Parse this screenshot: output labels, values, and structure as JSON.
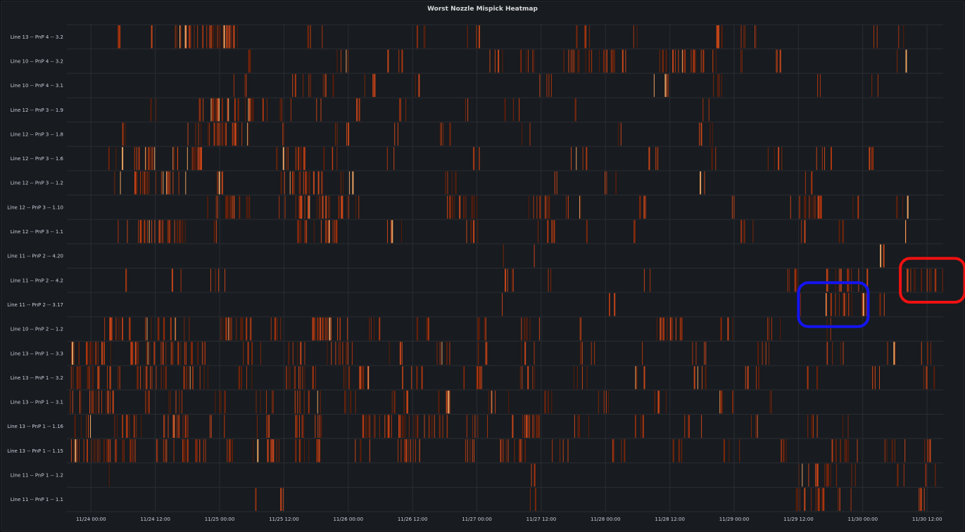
{
  "panel": {
    "title": "Worst Nozzle Mispick Heatmap"
  },
  "chart_data": {
    "type": "heatmap",
    "title": "Worst Nozzle Mispick Heatmap",
    "x_ticks": [
      "11/24 00:00",
      "11/24 12:00",
      "11/25 00:00",
      "11/25 12:00",
      "11/26 00:00",
      "11/26 12:00",
      "11/27 00:00",
      "11/27 12:00",
      "11/28 00:00",
      "11/28 12:00",
      "11/29 00:00",
      "11/29 12:00",
      "11/30 00:00",
      "11/30 12:00"
    ],
    "rows": [
      "Line 13 -- PnP 4 -- 3.2",
      "Line 10 -- PnP 4 -- 3.2",
      "Line 10 -- PnP 4 -- 3.1",
      "Line 12 -- PnP 3 -- 1.9",
      "Line 12 -- PnP 3 -- 1.8",
      "Line 12 -- PnP 3 -- 1.6",
      "Line 12 -- PnP 3 -- 1.2",
      "Line 12 -- PnP 3 -- 1.10",
      "Line 12 -- PnP 3 -- 1.1",
      "Line 11 -- PnP 2 -- 4.20",
      "Line 11 -- PnP 2 -- 4.2",
      "Line 11 -- PnP 2 -- 3.17",
      "Line 10 -- PnP 2 -- 1.2",
      "Line 13 -- PnP 1 -- 3.3",
      "Line 13 -- PnP 1 -- 3.2",
      "Line 13 -- PnP 1 -- 3.1",
      "Line 13 -- PnP 1 -- 1.16",
      "Line 13 -- PnP 1 -- 1.15",
      "Line 11 -- PnP 1 -- 1.2",
      "Line 11 -- PnP 1 -- 1.1"
    ],
    "x_range_hours": [
      -4.5,
      159
    ],
    "activity": [
      [
        [
          3,
          3
        ],
        [
          11,
          1
        ],
        [
          15,
          6
        ],
        [
          20,
          8
        ],
        [
          25,
          3
        ],
        [
          40,
          4
        ],
        [
          60,
          3
        ],
        [
          70,
          4
        ],
        [
          90,
          3
        ],
        [
          100,
          2
        ],
        [
          116,
          3
        ],
        [
          121,
          4
        ],
        [
          145,
          2
        ],
        [
          150,
          2
        ]
      ],
      [
        [
          28,
          2
        ],
        [
          45,
          3
        ],
        [
          55,
          3
        ],
        [
          74,
          3
        ],
        [
          80,
          4
        ],
        [
          88,
          10
        ],
        [
          97,
          3
        ],
        [
          106,
          8
        ],
        [
          113,
          4
        ],
        [
          120,
          2
        ],
        [
          127,
          3
        ],
        [
          150,
          2
        ]
      ],
      [
        [
          26,
          3
        ],
        [
          37,
          4
        ],
        [
          43,
          3
        ],
        [
          50,
          3
        ],
        [
          60,
          2
        ],
        [
          83,
          3
        ],
        [
          105,
          3
        ],
        [
          116,
          3
        ],
        [
          135,
          2
        ],
        [
          145,
          2
        ]
      ],
      [
        [
          11,
          2
        ],
        [
          20,
          5
        ],
        [
          22,
          8
        ],
        [
          30,
          3
        ],
        [
          35,
          3
        ],
        [
          42,
          2
        ],
        [
          48,
          2
        ],
        [
          56,
          3
        ],
        [
          69,
          2
        ],
        [
          77,
          3
        ],
        [
          90,
          2
        ],
        [
          114,
          2
        ]
      ],
      [
        [
          5,
          2
        ],
        [
          18,
          3
        ],
        [
          21,
          9
        ],
        [
          35,
          2
        ],
        [
          45,
          3
        ],
        [
          56,
          2
        ],
        [
          64,
          3
        ],
        [
          80,
          2
        ],
        [
          97,
          2
        ],
        [
          113,
          3
        ]
      ],
      [
        [
          3,
          3
        ],
        [
          7,
          6
        ],
        [
          15,
          6
        ],
        [
          18,
          3
        ],
        [
          34,
          6
        ],
        [
          43,
          3
        ],
        [
          55,
          2
        ],
        [
          70,
          3
        ],
        [
          89,
          4
        ],
        [
          103,
          3
        ],
        [
          115,
          2
        ],
        [
          126,
          3
        ],
        [
          135,
          3
        ],
        [
          144,
          3
        ]
      ],
      [
        [
          4,
          2
        ],
        [
          7,
          8
        ],
        [
          14,
          4
        ],
        [
          23,
          3
        ],
        [
          35,
          6
        ],
        [
          41,
          3
        ],
        [
          46,
          3
        ],
        [
          66,
          3
        ],
        [
          85,
          2
        ],
        [
          95,
          3
        ],
        [
          113,
          2
        ],
        [
          133,
          2
        ]
      ],
      [
        [
          21,
          9
        ],
        [
          35,
          2
        ],
        [
          38,
          9
        ],
        [
          46,
          4
        ],
        [
          66,
          6
        ],
        [
          81,
          5
        ],
        [
          88,
          4
        ],
        [
          102,
          3
        ],
        [
          118,
          2
        ],
        [
          130,
          8
        ],
        [
          142,
          2
        ],
        [
          150,
          3
        ]
      ],
      [
        [
          5,
          2
        ],
        [
          8,
          10
        ],
        [
          22,
          2
        ],
        [
          38,
          8
        ],
        [
          55,
          3
        ],
        [
          70,
          3
        ],
        [
          83,
          4
        ],
        [
          92,
          2
        ],
        [
          101,
          2
        ],
        [
          121,
          3
        ],
        [
          132,
          2
        ],
        [
          139,
          2
        ],
        [
          150,
          2
        ]
      ],
      [
        [
          76,
          1
        ],
        [
          82,
          1
        ],
        [
          147,
          1
        ]
      ],
      [
        [
          5,
          2
        ],
        [
          15,
          2
        ],
        [
          22,
          3
        ],
        [
          76,
          3
        ],
        [
          85,
          2
        ],
        [
          103,
          2
        ],
        [
          128,
          4
        ],
        [
          137,
          5
        ],
        [
          143,
          2
        ],
        [
          152,
          12
        ]
      ],
      [
        [
          76,
          1
        ],
        [
          96,
          2
        ],
        [
          131,
          2
        ],
        [
          137,
          8
        ],
        [
          146,
          2
        ]
      ],
      [
        [
          2,
          6
        ],
        [
          10,
          6
        ],
        [
          17,
          2
        ],
        [
          24,
          6
        ],
        [
          33,
          3
        ],
        [
          40,
          8
        ],
        [
          50,
          4
        ],
        [
          60,
          3
        ],
        [
          72,
          3
        ],
        [
          80,
          4
        ],
        [
          91,
          2
        ],
        [
          105,
          6
        ],
        [
          117,
          3
        ],
        [
          126,
          3
        ],
        [
          137,
          2
        ]
      ],
      [
        [
          -4,
          8
        ],
        [
          7,
          5
        ],
        [
          13,
          6
        ],
        [
          19,
          3
        ],
        [
          28,
          4
        ],
        [
          36,
          4
        ],
        [
          44,
          5
        ],
        [
          55,
          3
        ],
        [
          63,
          4
        ],
        [
          72,
          3
        ],
        [
          80,
          4
        ],
        [
          90,
          4
        ],
        [
          101,
          2
        ],
        [
          112,
          3
        ],
        [
          124,
          3
        ],
        [
          137,
          4
        ],
        [
          147,
          3
        ],
        [
          154,
          3
        ]
      ],
      [
        [
          -4,
          10
        ],
        [
          8,
          6
        ],
        [
          17,
          5
        ],
        [
          27,
          4
        ],
        [
          36,
          6
        ],
        [
          47,
          5
        ],
        [
          58,
          4
        ],
        [
          69,
          5
        ],
        [
          79,
          4
        ],
        [
          90,
          4
        ],
        [
          101,
          3
        ],
        [
          112,
          3
        ],
        [
          122,
          3
        ],
        [
          133,
          3
        ],
        [
          145,
          3
        ],
        [
          155,
          3
        ]
      ],
      [
        [
          -4,
          8
        ],
        [
          7,
          4
        ],
        [
          13,
          4
        ],
        [
          22,
          3
        ],
        [
          30,
          4
        ],
        [
          38,
          5
        ],
        [
          47,
          3
        ],
        [
          56,
          4
        ],
        [
          64,
          3
        ],
        [
          74,
          4
        ],
        [
          84,
          3
        ],
        [
          94,
          3
        ],
        [
          105,
          3
        ],
        [
          116,
          4
        ],
        [
          125,
          2
        ]
      ],
      [
        [
          -4,
          4
        ],
        [
          4,
          6
        ],
        [
          13,
          6
        ],
        [
          22,
          3
        ],
        [
          30,
          4
        ],
        [
          38,
          5
        ],
        [
          50,
          12
        ],
        [
          62,
          5
        ],
        [
          70,
          4
        ],
        [
          78,
          6
        ],
        [
          90,
          3
        ],
        [
          100,
          3
        ],
        [
          110,
          4
        ],
        [
          122,
          3
        ],
        [
          133,
          3
        ],
        [
          140,
          2
        ]
      ],
      [
        [
          -4,
          8
        ],
        [
          3,
          6
        ],
        [
          12,
          10
        ],
        [
          24,
          3
        ],
        [
          30,
          6
        ],
        [
          38,
          5
        ],
        [
          48,
          4
        ],
        [
          57,
          5
        ],
        [
          68,
          4
        ],
        [
          76,
          5
        ],
        [
          86,
          3
        ],
        [
          97,
          3
        ],
        [
          108,
          4
        ],
        [
          118,
          3
        ],
        [
          128,
          3
        ],
        [
          138,
          5
        ],
        [
          148,
          4
        ],
        [
          155,
          3
        ]
      ],
      [
        [
          3,
          1
        ],
        [
          81,
          2
        ],
        [
          132,
          6
        ],
        [
          139,
          4
        ],
        [
          150,
          2
        ],
        [
          155,
          3
        ]
      ],
      [
        [
          29,
          2
        ],
        [
          35,
          2
        ],
        [
          81,
          2
        ],
        [
          131,
          6
        ],
        [
          139,
          3
        ],
        [
          154,
          3
        ]
      ]
    ],
    "highlights": [
      {
        "shape": "rounded-rect",
        "color": "#1414f0",
        "around_row": "Line 11 -- PnP 2 -- 3.17",
        "x_hours": [
          132,
          145
        ]
      },
      {
        "shape": "rounded-rect",
        "color": "#ee1111",
        "around_row": "Line 11 -- PnP 2 -- 4.2",
        "x_hours": [
          151,
          163
        ]
      }
    ],
    "colors": {
      "background": "#181b1f",
      "grid": "#2a2d33",
      "cell_low": "#5a1d0a",
      "cell_mid": "#a8350f",
      "cell_high": "#e8a060"
    }
  }
}
